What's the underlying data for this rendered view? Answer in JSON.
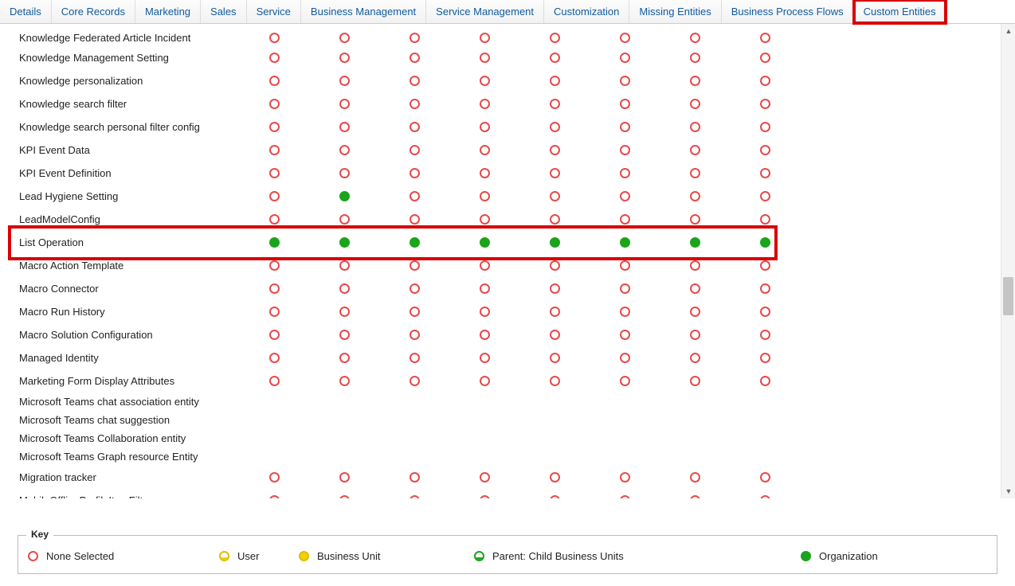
{
  "tabs": [
    {
      "label": "Details",
      "highlighted": false
    },
    {
      "label": "Core Records",
      "highlighted": false
    },
    {
      "label": "Marketing",
      "highlighted": false
    },
    {
      "label": "Sales",
      "highlighted": false
    },
    {
      "label": "Service",
      "highlighted": false
    },
    {
      "label": "Business Management",
      "highlighted": false
    },
    {
      "label": "Service Management",
      "highlighted": false
    },
    {
      "label": "Customization",
      "highlighted": false
    },
    {
      "label": "Missing Entities",
      "highlighted": false
    },
    {
      "label": "Business Process Flows",
      "highlighted": false
    },
    {
      "label": "Custom Entities",
      "highlighted": true
    }
  ],
  "legend": {
    "title": "Key",
    "none": "None Selected",
    "user": "User",
    "bu": "Business Unit",
    "parent": "Parent: Child Business Units",
    "org": "Organization"
  },
  "privilege_columns_count": 8,
  "rows": [
    {
      "label": "Knowledge Federated Article Incident",
      "privs": [
        "none",
        "none",
        "none",
        "none",
        "none",
        "none",
        "none",
        "none"
      ],
      "highlighted": false
    },
    {
      "label": "Knowledge Management Setting",
      "privs": [
        "none",
        "none",
        "none",
        "none",
        "none",
        "none",
        "none",
        "none"
      ],
      "highlighted": false
    },
    {
      "label": "Knowledge personalization",
      "privs": [
        "none",
        "none",
        "none",
        "none",
        "none",
        "none",
        "none",
        "none"
      ],
      "highlighted": false
    },
    {
      "label": "Knowledge search filter",
      "privs": [
        "none",
        "none",
        "none",
        "none",
        "none",
        "none",
        "none",
        "none"
      ],
      "highlighted": false
    },
    {
      "label": "Knowledge search personal filter config",
      "privs": [
        "none",
        "none",
        "none",
        "none",
        "none",
        "none",
        "none",
        "none"
      ],
      "highlighted": false
    },
    {
      "label": "KPI Event Data",
      "privs": [
        "none",
        "none",
        "none",
        "none",
        "none",
        "none",
        "none",
        "none"
      ],
      "highlighted": false
    },
    {
      "label": "KPI Event Definition",
      "privs": [
        "none",
        "none",
        "none",
        "none",
        "none",
        "none",
        "none",
        "none"
      ],
      "highlighted": false
    },
    {
      "label": "Lead Hygiene Setting",
      "privs": [
        "none",
        "org",
        "none",
        "none",
        "none",
        "none",
        "none",
        "none"
      ],
      "highlighted": false
    },
    {
      "label": "LeadModelConfig",
      "privs": [
        "none",
        "none",
        "none",
        "none",
        "none",
        "none",
        "none",
        "none"
      ],
      "highlighted": false
    },
    {
      "label": "List Operation",
      "privs": [
        "org",
        "org",
        "org",
        "org",
        "org",
        "org",
        "org",
        "org"
      ],
      "highlighted": true
    },
    {
      "label": "Macro Action Template",
      "privs": [
        "none",
        "none",
        "none",
        "none",
        "none",
        "none",
        "none",
        "none"
      ],
      "highlighted": false
    },
    {
      "label": "Macro Connector",
      "privs": [
        "none",
        "none",
        "none",
        "none",
        "none",
        "none",
        "none",
        "none"
      ],
      "highlighted": false
    },
    {
      "label": "Macro Run History",
      "privs": [
        "none",
        "none",
        "none",
        "none",
        "none",
        "none",
        "none",
        "none"
      ],
      "highlighted": false
    },
    {
      "label": "Macro Solution Configuration",
      "privs": [
        "none",
        "none",
        "none",
        "none",
        "none",
        "none",
        "none",
        "none"
      ],
      "highlighted": false
    },
    {
      "label": "Managed Identity",
      "privs": [
        "none",
        "none",
        "none",
        "none",
        "none",
        "none",
        "none",
        "none"
      ],
      "highlighted": false
    },
    {
      "label": "Marketing Form Display Attributes",
      "privs": [
        "none",
        "none",
        "none",
        "none",
        "none",
        "none",
        "none",
        "none"
      ],
      "highlighted": false
    },
    {
      "label": "Microsoft Teams chat association entity",
      "privs": [],
      "highlighted": false
    },
    {
      "label": "Microsoft Teams chat suggestion",
      "privs": [],
      "highlighted": false
    },
    {
      "label": "Microsoft Teams Collaboration entity",
      "privs": [],
      "highlighted": false
    },
    {
      "label": "Microsoft Teams Graph resource Entity",
      "privs": [],
      "highlighted": false
    },
    {
      "label": "Migration tracker",
      "privs": [
        "none",
        "none",
        "none",
        "none",
        "none",
        "none",
        "none",
        "none"
      ],
      "highlighted": false
    },
    {
      "label": "MobileOfflineProfileItemFilter",
      "privs": [
        "none",
        "none",
        "none",
        "none",
        "none",
        "none",
        "none",
        "none"
      ],
      "highlighted": false
    }
  ]
}
